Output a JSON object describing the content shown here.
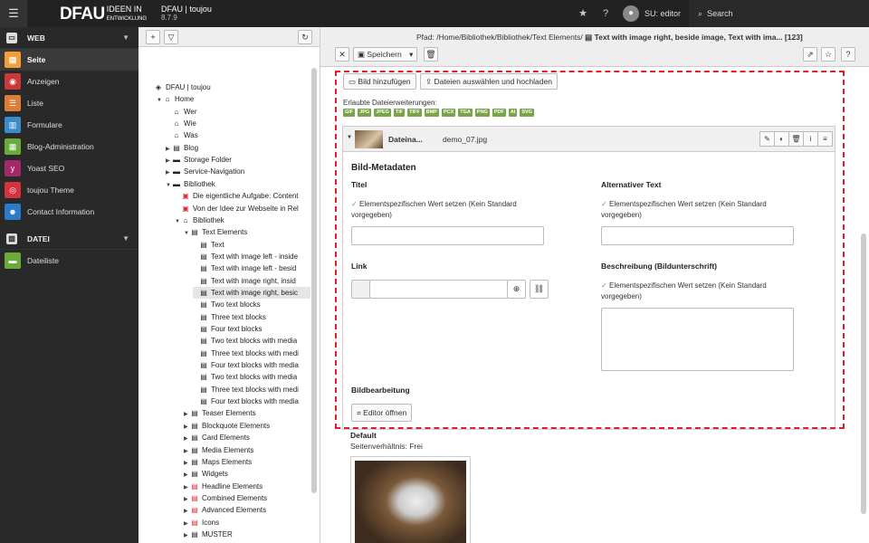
{
  "topbar": {
    "logo_bold": "DFAU",
    "logo_tag1": "IDEEN IN",
    "logo_tag2": "ENTWICKLUNG",
    "site_name": "DFAU | toujou",
    "version": "8.7.9",
    "user": "SU: editor",
    "search": "Search"
  },
  "sidebar": {
    "groups": [
      {
        "label": "WEB",
        "items": [
          {
            "label": "Seite",
            "icon": "page-icon",
            "color": "#f49e38"
          },
          {
            "label": "Anzeigen",
            "icon": "eye-icon",
            "color": "#c73a39"
          },
          {
            "label": "Liste",
            "icon": "list-icon",
            "color": "#de7d37"
          },
          {
            "label": "Formulare",
            "icon": "form-icon",
            "color": "#3a8ccb"
          },
          {
            "label": "Blog-Administration",
            "icon": "blog-icon",
            "color": "#6bab3b"
          },
          {
            "label": "Yoast SEO",
            "icon": "yoast-icon",
            "color": "#a4286a"
          },
          {
            "label": "toujou Theme",
            "icon": "fingerprint-icon",
            "color": "#d6323e"
          },
          {
            "label": "Contact Information",
            "icon": "contacts-icon",
            "color": "#2d7bc8"
          }
        ]
      },
      {
        "label": "DATEI",
        "items": [
          {
            "label": "Dateiliste",
            "icon": "folder-icon",
            "color": "#6bab3b"
          }
        ]
      }
    ]
  },
  "tree": {
    "nodes": [
      "DFAU | toujou",
      "Home",
      "Wer",
      "Wie",
      "Was",
      "Blog",
      "Storage Folder",
      "Service-Navigation",
      "Bibliothek",
      "Die eigentliche Aufgabe: Content",
      "Von der Idee zur Webseite in Rel",
      "Bibliothek",
      "Text Elements",
      "Text",
      "Text with image left - inside",
      "Text with image left - besid",
      "Text with image right, insid",
      "Text with image right, besic",
      "Two text blocks",
      "Three text blocks",
      "Four text blocks",
      "Two text blocks with media",
      "Three text blocks with medi",
      "Four text blocks with media",
      "Two text blocks with media",
      "Three text blocks with medi",
      "Four text blocks with media",
      "Teaser Elements",
      "Blockquote Elements",
      "Card Elements",
      "Media Elements",
      "Maps Elements",
      "Widgets",
      "Headline Elements",
      "Combined Elements",
      "Advanced Elements",
      "Icons",
      "MUSTER"
    ]
  },
  "docheader": {
    "path_prefix": "Pfad: /Home/Bibliothek/Bibliothek/Text Elements/",
    "path_title": "Text with image right, beside image, Text with ima... [123]",
    "save": "Speichern"
  },
  "form": {
    "add_image": "Bild hinzufügen",
    "upload": "Dateien auswählen und hochladen",
    "allowed": "Erlaubte Dateierweiterungen:",
    "extensions": [
      "GIF",
      "JPG",
      "JPEG",
      "TIF",
      "TIFF",
      "BMP",
      "PCX",
      "TGA",
      "PNG",
      "PDF",
      "AI",
      "SVG"
    ],
    "file_label": "Dateina...",
    "file_name": "demo_07.jpg",
    "meta_heading": "Bild-Metadaten",
    "title_label": "Titel",
    "alt_label": "Alternativer Text",
    "override": "Elementspezifischen Wert setzen (Kein Standard vorgegeben)",
    "link_label": "Link",
    "desc_label": "Beschreibung (Bildunterschrift)",
    "edit_heading": "Bildbearbeitung",
    "editor_btn": "Editor öffnen",
    "default": "Default",
    "ratio": "Seitenverhältnis: Frei"
  }
}
